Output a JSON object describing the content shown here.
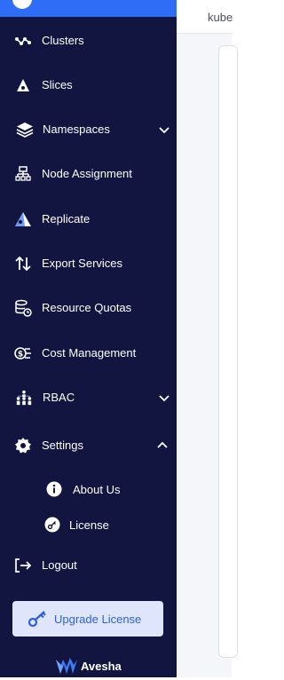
{
  "sidebar": {
    "items": [
      {
        "label": "Clusters",
        "icon": "clusters-icon"
      },
      {
        "label": "Slices",
        "icon": "slices-icon"
      },
      {
        "label": "Namespaces",
        "icon": "namespaces-icon",
        "expandable": true,
        "expanded": false
      },
      {
        "label": "Node Assignment",
        "icon": "node-assignment-icon"
      },
      {
        "label": "Replicate",
        "icon": "replicate-icon"
      },
      {
        "label": "Export Services",
        "icon": "export-services-icon"
      },
      {
        "label": "Resource Quotas",
        "icon": "resource-quotas-icon"
      },
      {
        "label": "Cost Management",
        "icon": "cost-management-icon"
      },
      {
        "label": "RBAC",
        "icon": "rbac-icon",
        "expandable": true,
        "expanded": false
      },
      {
        "label": "Settings",
        "icon": "settings-icon",
        "expandable": true,
        "expanded": true
      }
    ],
    "settings_children": [
      {
        "label": "About Us",
        "icon": "info-icon"
      },
      {
        "label": "License",
        "icon": "license-icon"
      }
    ],
    "logout": {
      "label": "Logout",
      "icon": "logout-icon"
    },
    "upgrade_label": "Upgrade License",
    "brand": "Avesha"
  },
  "content": {
    "tab_label": "kube"
  },
  "colors": {
    "sidebar_bg": "#12153f",
    "accent": "#2f6df6",
    "upgrade_bg": "#dfe6fb",
    "upgrade_text": "#2f5fd6"
  }
}
